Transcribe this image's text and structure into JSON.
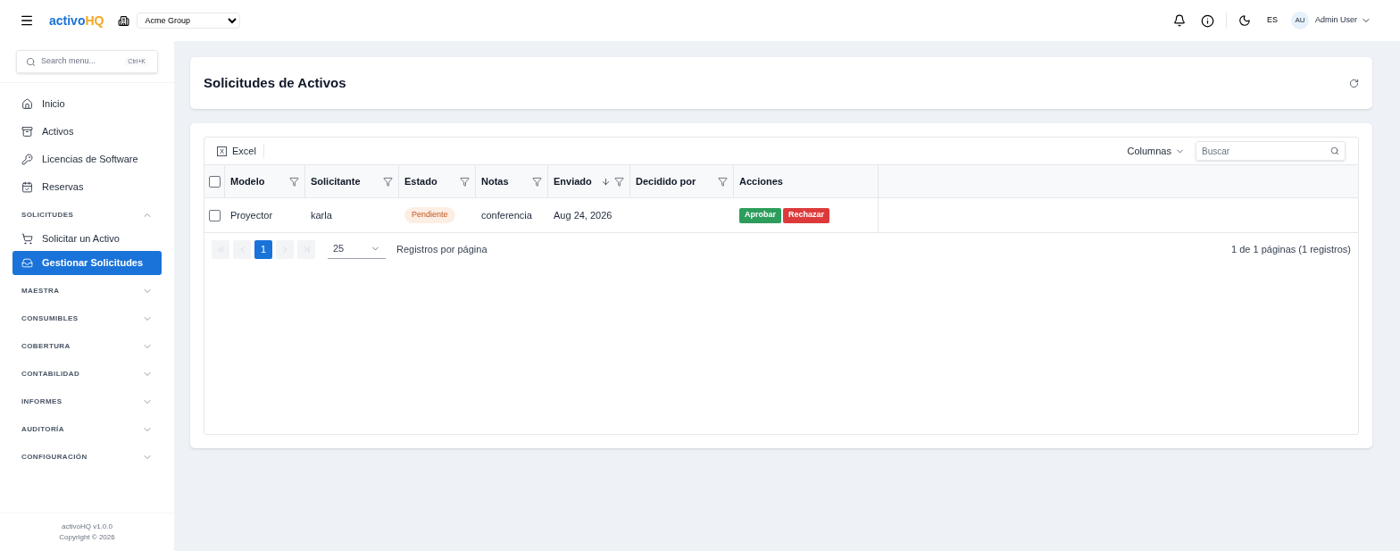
{
  "header": {
    "logo": {
      "part_1": "activo",
      "part_2": "HQ"
    },
    "organization": "Acme Group",
    "language": "ES",
    "user": {
      "initials": "AU",
      "name": "Admin User"
    }
  },
  "sidebar": {
    "search": {
      "placeholder": "Search menu...",
      "shortcut": "Ctrl+K"
    },
    "items": [
      {
        "kind": "link",
        "label": "Inicio",
        "selected": false
      },
      {
        "kind": "link",
        "label": "Activos",
        "selected": false
      },
      {
        "kind": "link",
        "label": "Licencias de Software",
        "selected": false
      },
      {
        "kind": "link",
        "label": "Reservas",
        "selected": false
      },
      {
        "kind": "section",
        "label": "SOLICITUDES",
        "expanded": true,
        "children": [
          {
            "label": "Solicitar un Activo",
            "selected": false
          },
          {
            "label": "Gestionar Solicitudes",
            "selected": true
          }
        ]
      },
      {
        "kind": "section",
        "label": "MAESTRA",
        "expanded": false
      },
      {
        "kind": "section",
        "label": "CONSUMIBLES",
        "expanded": false
      },
      {
        "kind": "section",
        "label": "COBERTURA",
        "expanded": false
      },
      {
        "kind": "section",
        "label": "CONTABILIDAD",
        "expanded": false
      },
      {
        "kind": "section",
        "label": "INFORMES",
        "expanded": false
      },
      {
        "kind": "section",
        "label": "AUDITORÍA",
        "expanded": false
      },
      {
        "kind": "section",
        "label": "CONFIGURACIÓN",
        "expanded": false
      }
    ],
    "footer": [
      "activoHQ v1.0.0",
      "Copyright © 2026"
    ]
  },
  "page_title": "Solicitudes de Activos",
  "table": {
    "export_icon": "X",
    "export_button": "Excel",
    "columns_button": "Columnas",
    "search": {
      "placeholder": "Buscar"
    },
    "select_all": {
      "checked": false
    },
    "columns": [
      {
        "label": "Modelo",
        "filterable": true,
        "sorted": false
      },
      {
        "label": "Solicitante",
        "filterable": true,
        "sorted": false
      },
      {
        "label": "Estado",
        "filterable": true,
        "sorted": false
      },
      {
        "label": "Notas",
        "filterable": true,
        "sorted": false
      },
      {
        "label": "Enviado",
        "filterable": true,
        "sorted": true
      },
      {
        "label": "Decidido por",
        "filterable": true,
        "sorted": false
      },
      {
        "label": "Acciones",
        "filterable": false,
        "sorted": false
      }
    ],
    "rows": [
      {
        "checked": false,
        "modelo": "Proyector",
        "solicitante": "karla",
        "estado": "Pendiente",
        "notas": "conferencia",
        "enviado": "Aug 24, 2026",
        "acciones": [
          {
            "label": "Aprobar",
            "kind": "approve"
          },
          {
            "label": "Rechazar",
            "kind": "reject"
          }
        ]
      }
    ]
  },
  "pagination": {
    "pages": [
      {
        "label": "1",
        "selected": true
      }
    ],
    "page_size": "25",
    "page_size_label": "Registros por página",
    "summary": "1 de 1 páginas (1 registros)"
  }
}
